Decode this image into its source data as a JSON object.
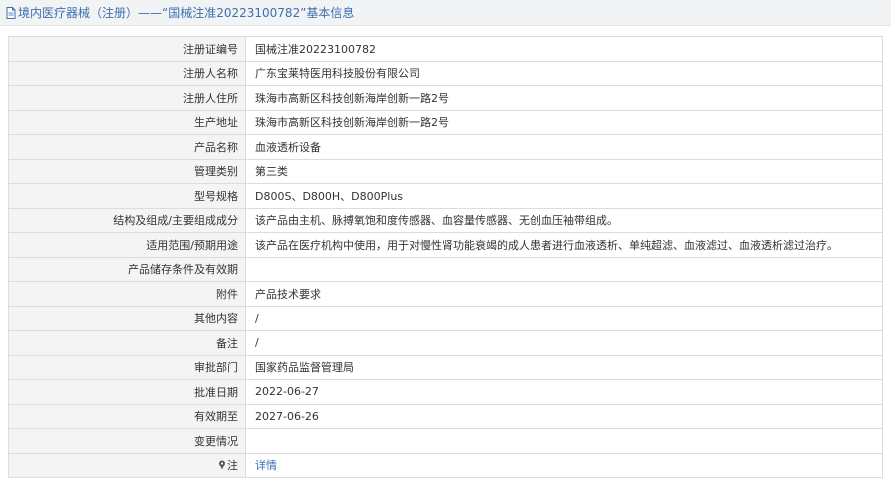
{
  "header": {
    "title": "境内医疗器械（注册）——“国械注准20223100782”基本信息"
  },
  "rows": [
    {
      "label": "注册证编号",
      "value": "国械注准20223100782"
    },
    {
      "label": "注册人名称",
      "value": "广东宝莱特医用科技股份有限公司"
    },
    {
      "label": "注册人住所",
      "value": "珠海市高新区科技创新海岸创新一路2号"
    },
    {
      "label": "生产地址",
      "value": "珠海市高新区科技创新海岸创新一路2号"
    },
    {
      "label": "产品名称",
      "value": "血液透析设备"
    },
    {
      "label": "管理类别",
      "value": "第三类"
    },
    {
      "label": "型号规格",
      "value": "D800S、D800H、D800Plus"
    },
    {
      "label": "结构及组成/主要组成成分",
      "value": "该产品由主机、脉搏氧饱和度传感器、血容量传感器、无创血压袖带组成。"
    },
    {
      "label": "适用范围/预期用途",
      "value": "该产品在医疗机构中使用，用于对慢性肾功能衰竭的成人患者进行血液透析、单纯超滤、血液滤过、血液透析滤过治疗。"
    },
    {
      "label": "产品储存条件及有效期",
      "value": ""
    },
    {
      "label": "附件",
      "value": "产品技术要求"
    },
    {
      "label": "其他内容",
      "value": "/"
    },
    {
      "label": "备注",
      "value": "/"
    },
    {
      "label": "审批部门",
      "value": "国家药品监督管理局"
    },
    {
      "label": "批准日期",
      "value": "2022-06-27"
    },
    {
      "label": "有效期至",
      "value": "2027-06-26"
    },
    {
      "label": "变更情况",
      "value": ""
    }
  ],
  "note_row": {
    "label": "注",
    "link": "详情"
  }
}
